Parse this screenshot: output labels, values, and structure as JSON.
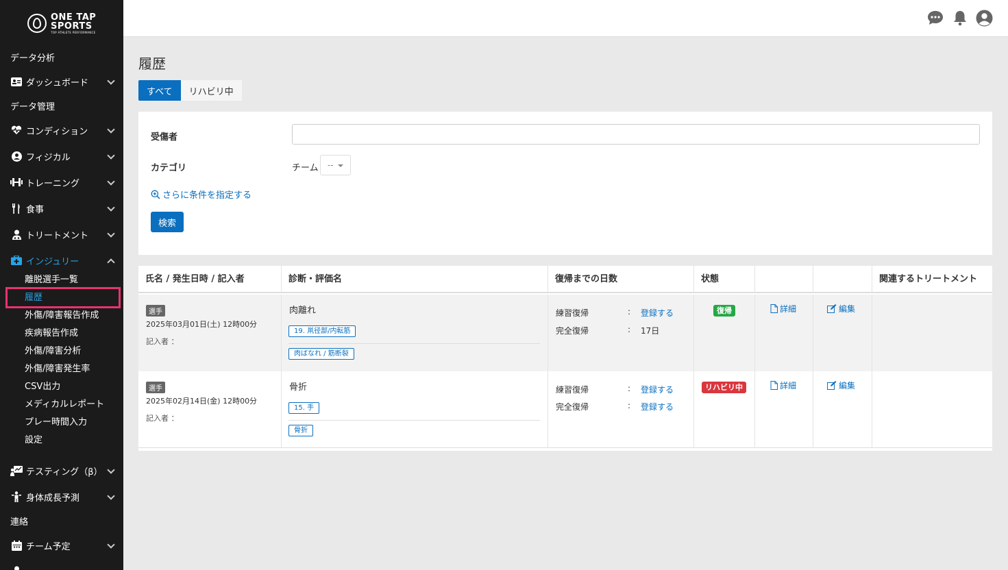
{
  "sidebar": {
    "logo": {
      "line1": "ONE TAP",
      "line2": "SPORTS",
      "line3": "TOP ATHLETE PERFORMANCE"
    },
    "items": [
      {
        "label": "データ分析"
      },
      {
        "label": "ダッシュボード"
      },
      {
        "label": "データ管理"
      },
      {
        "label": "コンディション"
      },
      {
        "label": "フィジカル"
      },
      {
        "label": "トレーニング"
      },
      {
        "label": "食事"
      },
      {
        "label": "トリートメント"
      },
      {
        "label": "インジュリー"
      },
      {
        "label": "テスティング（β）"
      },
      {
        "label": "身体成長予測"
      },
      {
        "label": "連絡"
      },
      {
        "label": "チーム予定"
      }
    ],
    "injury_sub": [
      "離脱選手一覧",
      "履歴",
      "外傷/障害報告作成",
      "疾病報告作成",
      "外傷/障害分析",
      "外傷/障害発生率",
      "CSV出力",
      "メディカルレポート",
      "プレー時間入力",
      "設定"
    ]
  },
  "page": {
    "title": "履歴",
    "tabs": [
      "すべて",
      "リハビリ中"
    ]
  },
  "filters": {
    "injured_label": "受傷者",
    "injured_value": "",
    "category_label": "カテゴリ",
    "team_label": "チーム",
    "team_select": "--",
    "more_conditions": "さらに条件を指定する",
    "search_button": "検索"
  },
  "table": {
    "headers": [
      "氏名 / 発生日時 / 記入者",
      "診断・評価名",
      "復帰までの日数",
      "状態",
      "",
      "",
      "関連するトリートメント"
    ],
    "rows": [
      {
        "role": "選手",
        "datetime": "2025年03月01日(土) 12時00分",
        "recorder": "記入者 ：",
        "diagnosis": "肉離れ",
        "tag1": "19. 鼡径部/内転筋",
        "tag2": "肉ばなれ / 筋断裂",
        "practice_label": "練習復帰",
        "practice_value": "登録する",
        "full_label": "完全復帰",
        "full_value": "17日",
        "status": "復帰",
        "detail": "詳細",
        "edit": "編集"
      },
      {
        "role": "選手",
        "datetime": "2025年02月14日(金) 12時00分",
        "recorder": "記入者 ：",
        "diagnosis": "骨折",
        "tag1": "15. 手",
        "tag2": "骨折",
        "practice_label": "練習復帰",
        "practice_value": "登録する",
        "full_label": "完全復帰",
        "full_value": "登録する",
        "status": "リハビリ中",
        "detail": "詳細",
        "edit": "編集"
      }
    ],
    "colon": ":"
  },
  "colors": {
    "sidebar_bg": "#1b1b1b",
    "accent": "#0a6fbf",
    "active_link": "#2aa3e6",
    "highlight": "#e8336d",
    "status_green": "#27a745",
    "status_red": "#d9363e"
  }
}
